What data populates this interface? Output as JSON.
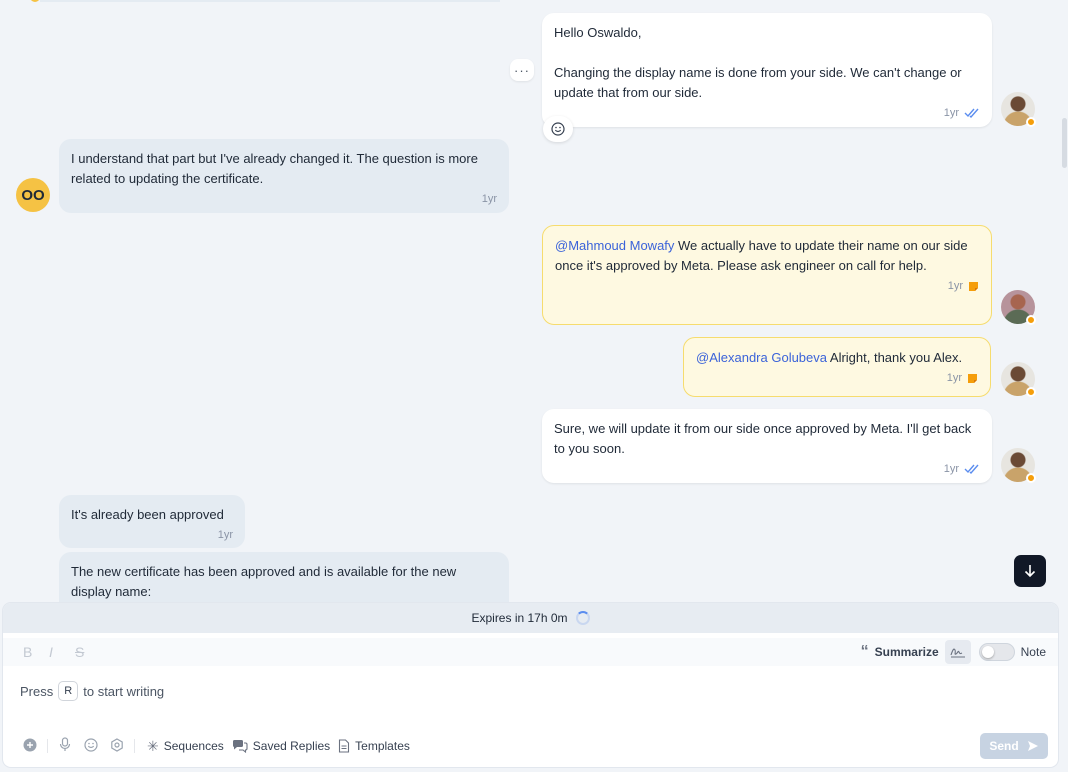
{
  "messages": {
    "m1": {
      "text": "Hello Oswaldo,\n\nChanging the display name is done from your side. We can't change or update that from our side.",
      "time": "1yr"
    },
    "m2": {
      "text": "I understand that part but I've already changed it. The question is more related to updating the certificate.",
      "time": "1yr",
      "initials": "OO"
    },
    "m3": {
      "mention": "@Mahmoud Mowafy",
      "text": " We actually have to update their name on our side once it's approved by Meta. Please ask engineer on call for help.",
      "time": "1yr"
    },
    "m4": {
      "mention": "@Alexandra Golubeva",
      "text": " Alright, thank you Alex.",
      "time": "1yr"
    },
    "m5": {
      "text": "Sure, we will update it from our side once approved by Meta. I'll get back to you soon.",
      "time": "1yr"
    },
    "m6": {
      "text": "It's already been approved",
      "time": "1yr"
    },
    "m7": {
      "text": "The new certificate has been approved and is available for the new display name:"
    }
  },
  "composer": {
    "expiry": "Expires in 17h 0m",
    "format": {
      "bold": "B",
      "italic": "I",
      "strike": "S"
    },
    "summarize": "Summarize",
    "note": "Note",
    "placeholder_pre": "Press",
    "placeholder_key": "R",
    "placeholder_post": "to start writing",
    "sequences": "Sequences",
    "saved_replies": "Saved Replies",
    "templates": "Templates",
    "send": "Send"
  },
  "icons": {
    "read_receipt": "double-check-icon",
    "note_marker": "note-icon",
    "scroll_down": "arrow-down-icon"
  },
  "colors": {
    "accent": "#3b63d9",
    "note_bg": "#fef9e1",
    "note_border": "#f6dc6e",
    "status_dot": "#f59e0b",
    "contact_avatar": "#f5c244"
  }
}
